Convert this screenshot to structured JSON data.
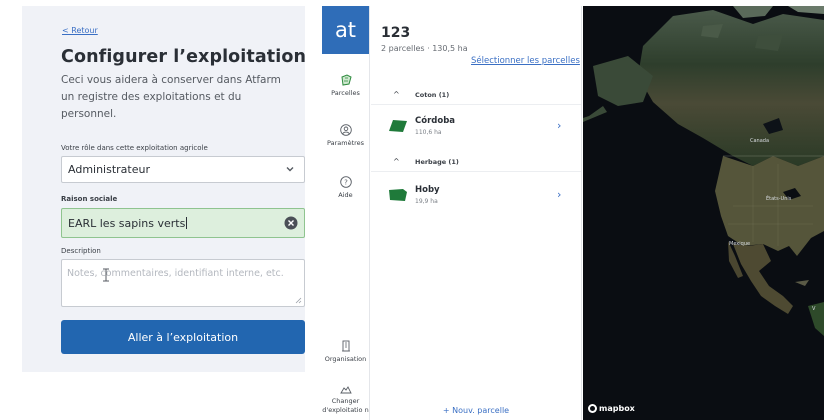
{
  "form": {
    "back_label": "< Retour",
    "title": "Configurer l’exploitation",
    "description": "Ceci vous aidera à conserver dans Atfarm un registre des exploitations et du personnel.",
    "role_label": "Votre rôle dans cette exploitation agricole",
    "role_value": "Administrateur",
    "raison_label": "Raison sociale",
    "raison_value": "EARL les sapins verts",
    "description_label": "Description",
    "description_placeholder": "Notes, commentaires, identifiant interne, etc.",
    "submit_label": "Aller à l’exploitation"
  },
  "app": {
    "logo": "at",
    "rail": {
      "parcelles": "Parcelles",
      "parametres": "Paramètres",
      "aide": "Aide",
      "organisation": "Organisation",
      "changer": "Changer d'exploitatio n"
    },
    "accent_color": "#2f6db8"
  },
  "exploitation": {
    "name": "123",
    "summary": "2 parcelles  ·  130,5 ha",
    "select_link": "Sélectionner les parcelles"
  },
  "groups": [
    {
      "name": "Coton (1)",
      "parcels": [
        {
          "name": "Córdoba",
          "area": "110,6 ha",
          "color": "#1f7a3a"
        }
      ]
    },
    {
      "name": "Herbage (1)",
      "parcels": [
        {
          "name": "Hoby",
          "area": "19,9 ha",
          "color": "#1f7a3a"
        }
      ]
    }
  ],
  "new_parcel_label": "+ Nouv. parcelle",
  "map": {
    "labels": {
      "canada": "Canada",
      "usa": "États-Unis",
      "mexico": "Mexique",
      "side": "V"
    },
    "attribution": "mapbox"
  }
}
